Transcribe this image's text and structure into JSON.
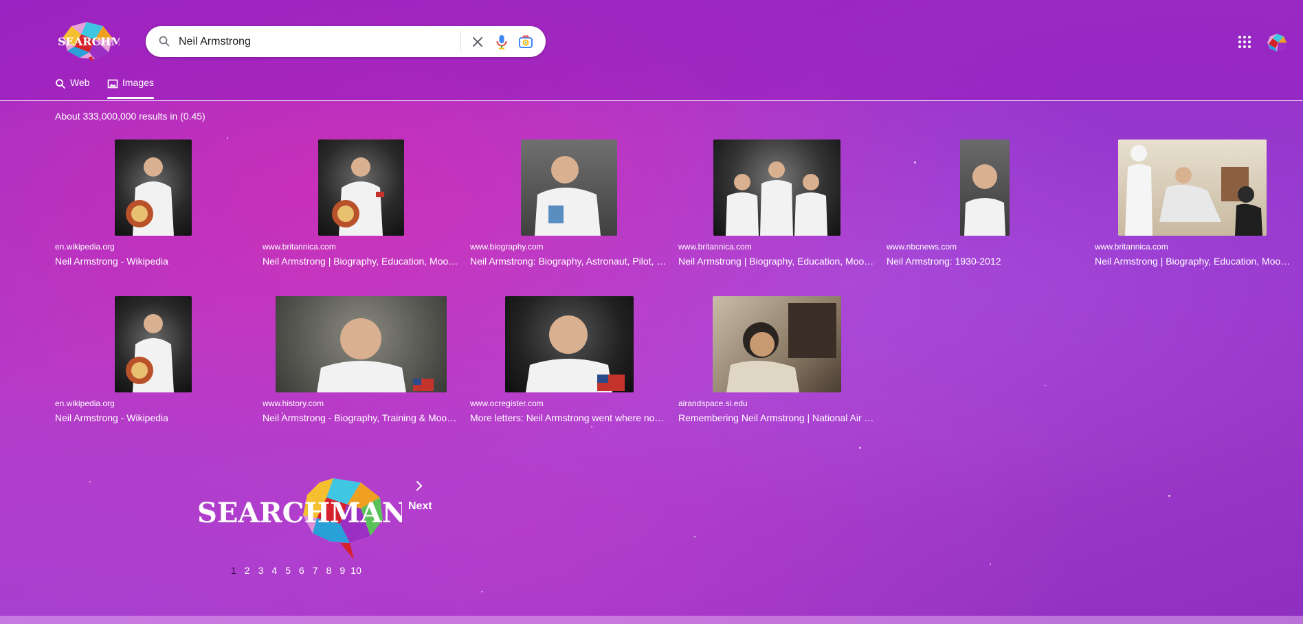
{
  "search": {
    "query": "Neil Armstrong"
  },
  "tabs": [
    {
      "label": "Web",
      "icon": "search-icon"
    },
    {
      "label": "Images",
      "icon": "image-icon",
      "active": true
    }
  ],
  "stats": "About 333,000,000 results in (0.45)",
  "results": [
    {
      "source": "en.wikipedia.org",
      "title": "Neil Armstrong - Wikipedia"
    },
    {
      "source": "www.britannica.com",
      "title": "Neil Armstrong | Biography, Education, Moon Landing"
    },
    {
      "source": "www.biography.com",
      "title": "Neil Armstrong: Biography, Astronaut, Pilot, Engineer"
    },
    {
      "source": "www.britannica.com",
      "title": "Neil Armstrong | Biography, Education, Moon Landing"
    },
    {
      "source": "www.nbcnews.com",
      "title": "Neil Armstrong: 1930-2012"
    },
    {
      "source": "www.britannica.com",
      "title": "Neil Armstrong | Biography, Education, Moon Landing"
    },
    {
      "source": "en.wikipedia.org",
      "title": "Neil Armstrong - Wikipedia"
    },
    {
      "source": "www.history.com",
      "title": "Neil Armstrong - Biography, Training & Moon Landing"
    },
    {
      "source": "www.ocregister.com",
      "title": "More letters: Neil Armstrong went where no man had gone"
    },
    {
      "source": "airandspace.si.edu",
      "title": "Remembering Neil Armstrong | National Air and Space Museum"
    }
  ],
  "pagination": {
    "next_label": "Next",
    "pages": [
      "1",
      "2",
      "3",
      "4",
      "5",
      "6",
      "7",
      "8",
      "9",
      "10"
    ],
    "current": "1"
  },
  "logo_text": "SEARCHMAN",
  "colors": {
    "accent": "#a63bcf",
    "header": "#9a2cc8",
    "brand_red": "#d6202a",
    "brand_orange": "#f0a020"
  }
}
